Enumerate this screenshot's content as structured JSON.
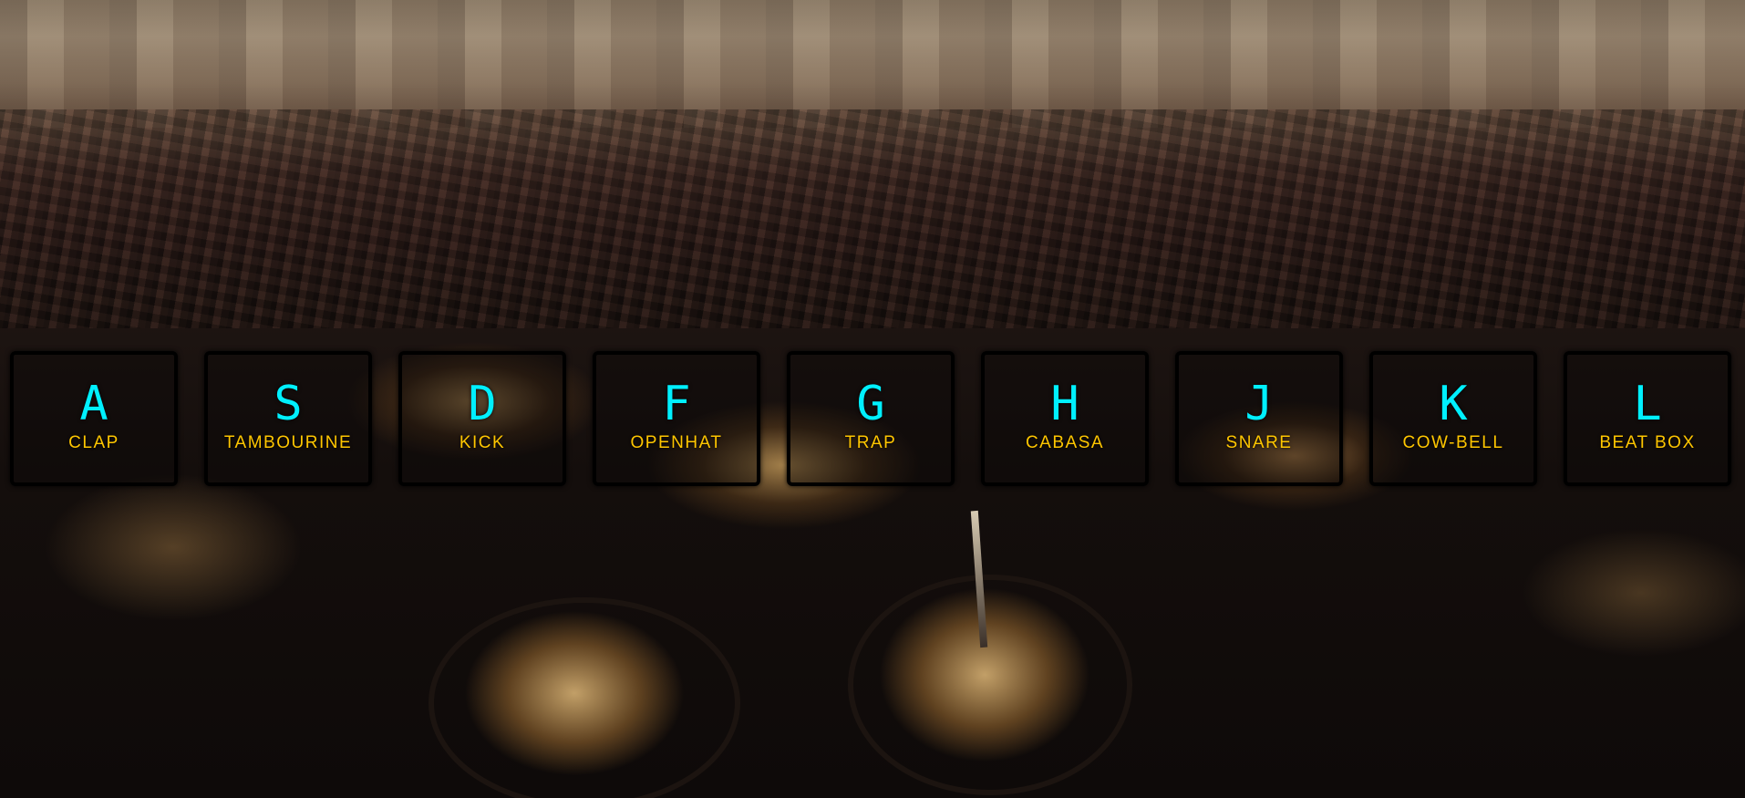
{
  "keys": [
    {
      "letter": "A",
      "sound": "CLAP"
    },
    {
      "letter": "S",
      "sound": "TAMBOURINE"
    },
    {
      "letter": "D",
      "sound": "KICK"
    },
    {
      "letter": "F",
      "sound": "OPENHAT"
    },
    {
      "letter": "G",
      "sound": "TRAP"
    },
    {
      "letter": "H",
      "sound": "CABASA"
    },
    {
      "letter": "J",
      "sound": "SNARE"
    },
    {
      "letter": "K",
      "sound": "COW-BELL"
    },
    {
      "letter": "L",
      "sound": "BEAT BOX"
    }
  ],
  "colors": {
    "letter": "#00f0ff",
    "sound_label": "#ffc600",
    "key_border": "#000000"
  }
}
